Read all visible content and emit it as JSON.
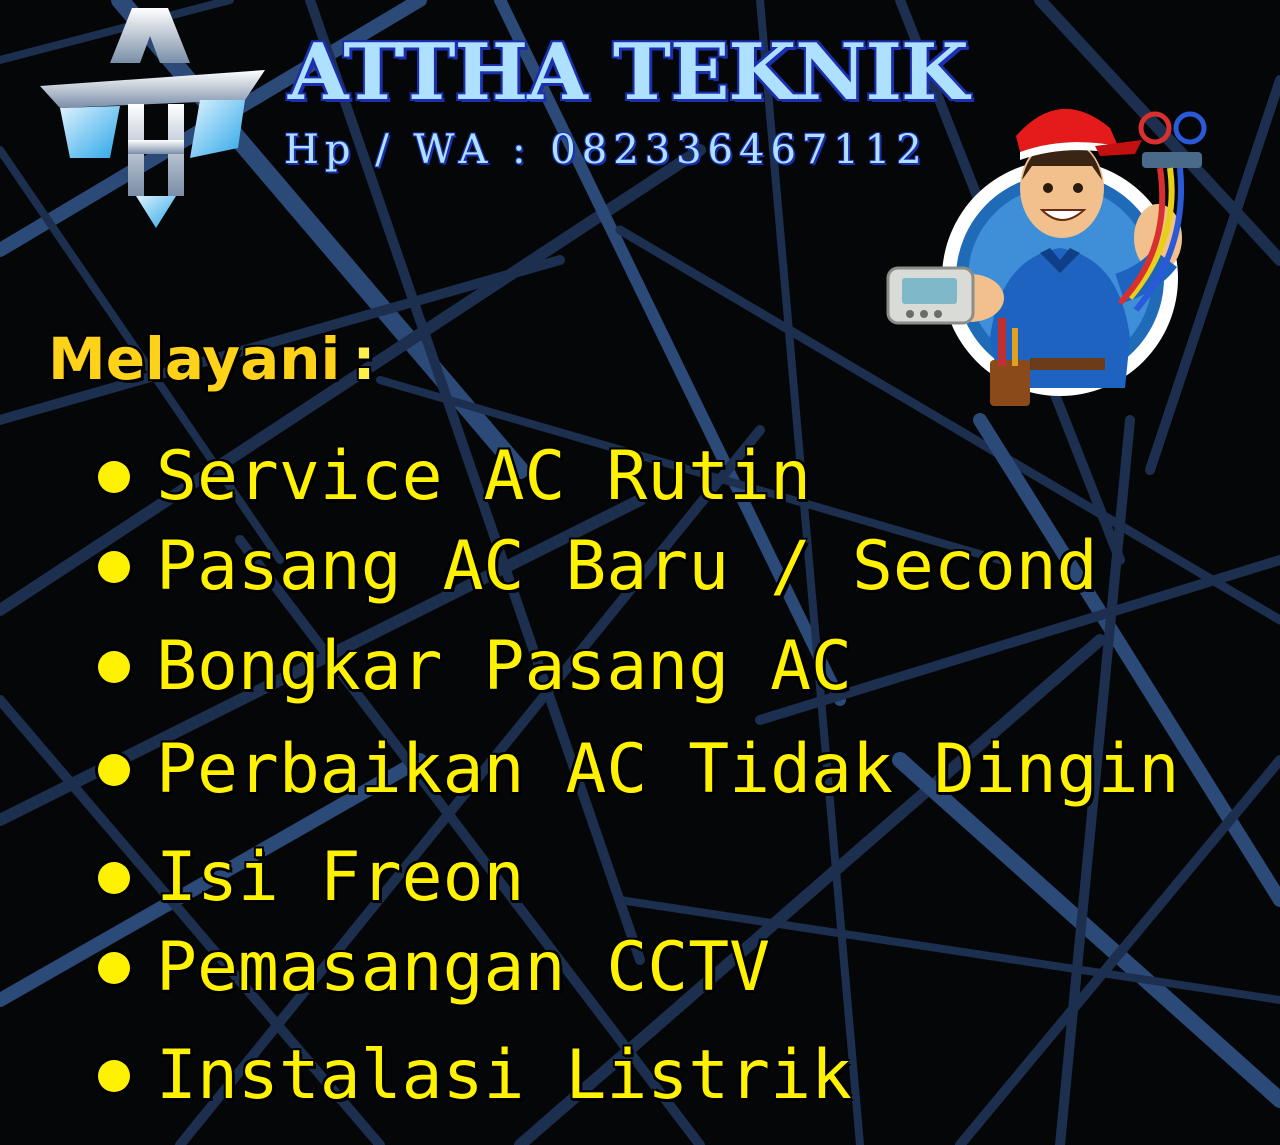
{
  "brand": {
    "name": "ATTHA TEKNIK",
    "contact": "Hp / WA : 082336467112",
    "logo_icon": "ath-monogram-icon"
  },
  "mascot": {
    "icon": "technician-mascot-icon"
  },
  "services": {
    "heading": "Melayani",
    "heading_suffix": ":",
    "items": [
      "Service AC Rutin",
      "Pasang AC Baru / Second",
      "Bongkar Pasang AC",
      "Perbaikan AC Tidak Dingin",
      "Isi Freon",
      "Pemasangan CCTV",
      "Instalasi Listrik"
    ]
  },
  "colors": {
    "background": "#050608",
    "accent_yellow": "#fff200",
    "heading_yellow": "#ffd21a",
    "brand_light_blue": "#aee0ff",
    "brand_outline_blue": "#1b2fb0",
    "line_blue": "#1c2f4f"
  }
}
